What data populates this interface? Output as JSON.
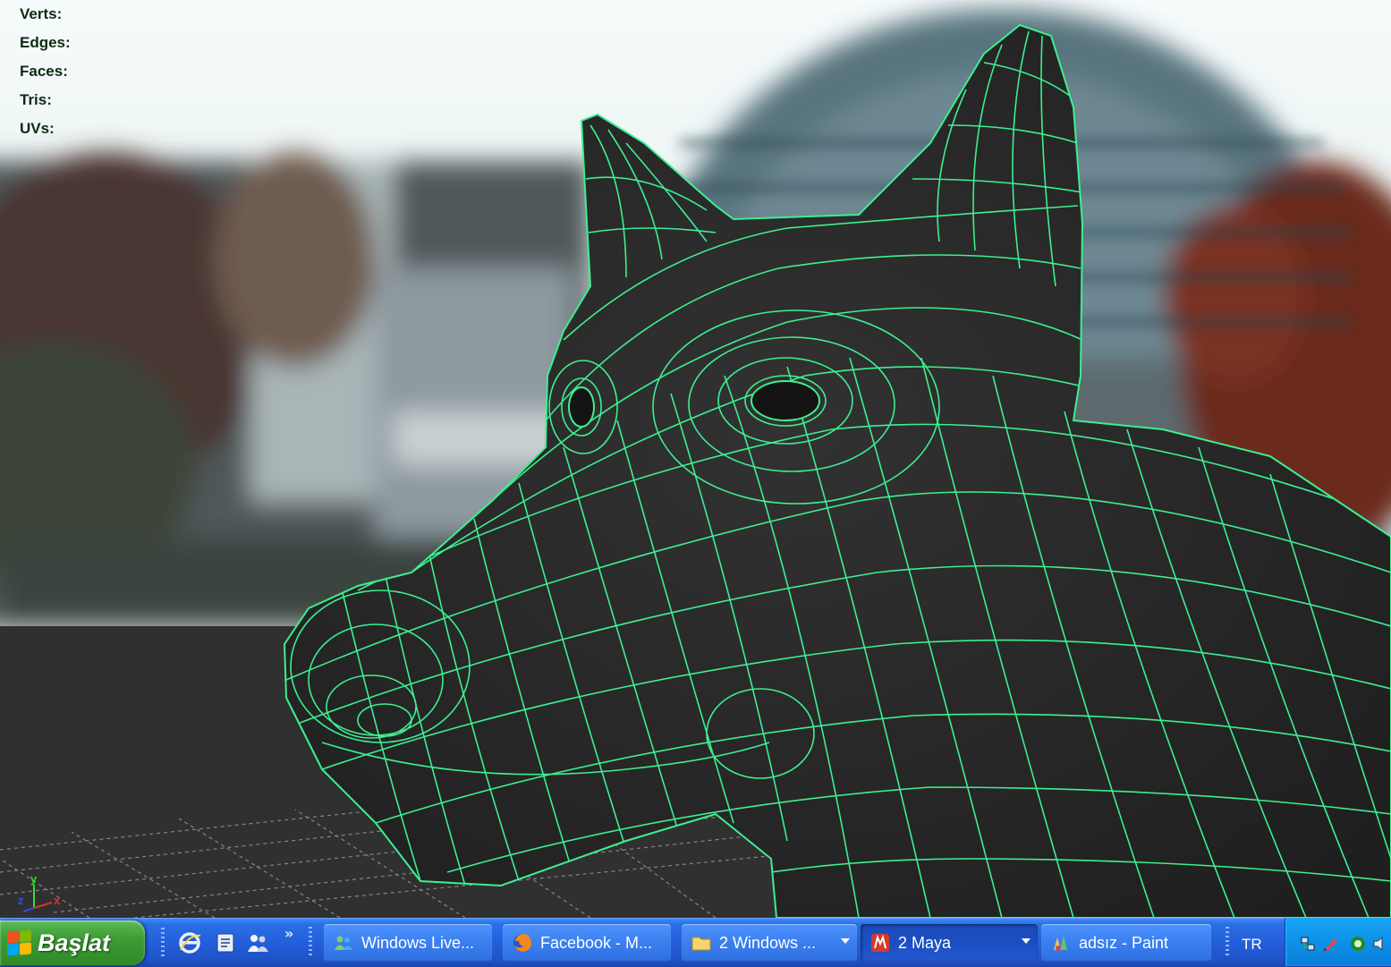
{
  "viewport": {
    "hud": {
      "verts_label": "Verts:",
      "edges_label": "Edges:",
      "faces_label": "Faces:",
      "tris_label": "Tris:",
      "uvs_label": "UVs:"
    },
    "axis": {
      "x": "x",
      "y": "y",
      "z": "z"
    },
    "wire_color": "#3cf08f",
    "mesh_color": "#2b2b2b"
  },
  "taskbar": {
    "start_label": "Başlat",
    "quick_launch_more": "»",
    "tasks": [
      {
        "label": "Windows Live...",
        "icon": "messenger-icon"
      },
      {
        "label": "Facebook - M...",
        "icon": "firefox-icon"
      },
      {
        "label": "2 Windows ...",
        "icon": "folder-icon"
      },
      {
        "label": "2 Maya",
        "icon": "maya-icon"
      },
      {
        "label": "adsız - Paint",
        "icon": "paint-icon"
      }
    ],
    "language": "TR"
  }
}
